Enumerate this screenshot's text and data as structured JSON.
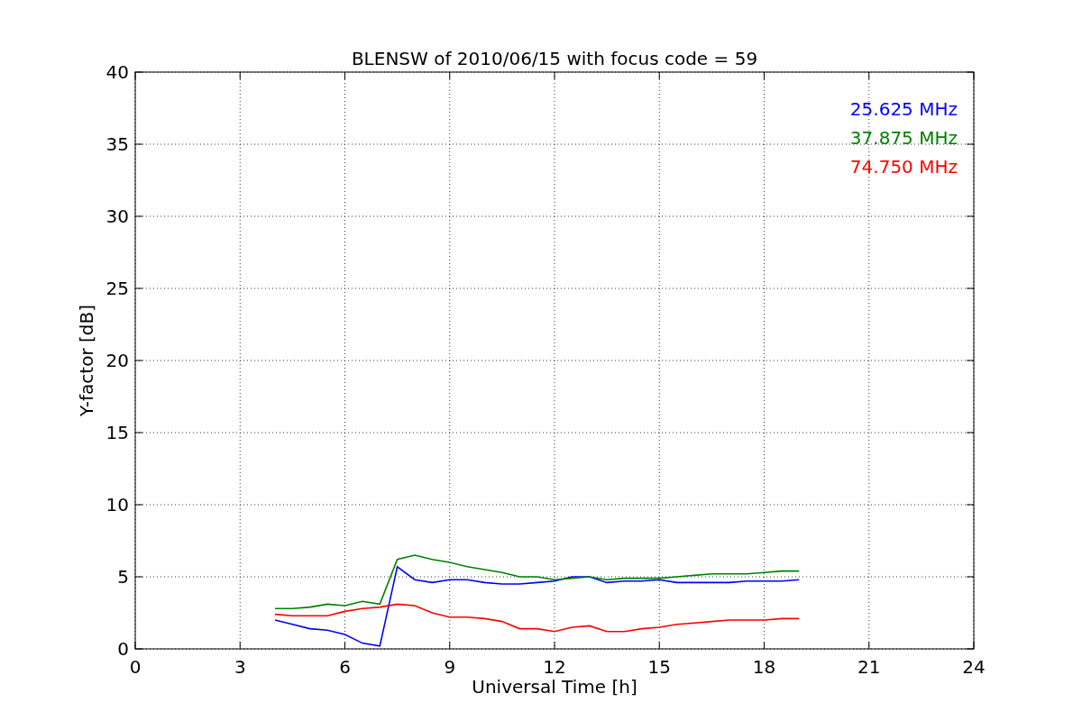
{
  "chart_data": {
    "type": "line",
    "title": "BLENSW of 2010/06/15 with focus code = 59",
    "xlabel": "Universal Time [h]",
    "ylabel": "Y-factor [dB]",
    "x": [
      4,
      4.5,
      5,
      5.5,
      6,
      6.5,
      7,
      7.5,
      8,
      8.5,
      9,
      9.5,
      10,
      10.5,
      11,
      11.5,
      12,
      12.5,
      13,
      13.5,
      14,
      14.5,
      15,
      15.5,
      16,
      16.5,
      17,
      17.5,
      18,
      18.5,
      19
    ],
    "series": [
      {
        "name": "25.625 MHz",
        "color": "#0000ff",
        "values": [
          2.0,
          1.7,
          1.4,
          1.3,
          1.0,
          0.4,
          0.2,
          5.7,
          4.8,
          4.6,
          4.8,
          4.8,
          4.6,
          4.5,
          4.5,
          4.6,
          4.7,
          5.0,
          5.0,
          4.6,
          4.7,
          4.7,
          4.8,
          4.6,
          4.6,
          4.6,
          4.6,
          4.7,
          4.7,
          4.7,
          4.8
        ]
      },
      {
        "name": "37.875 MHz",
        "color": "#008000",
        "values": [
          2.8,
          2.8,
          2.9,
          3.1,
          3.0,
          3.3,
          3.1,
          6.2,
          6.5,
          6.2,
          6.0,
          5.7,
          5.5,
          5.3,
          5.0,
          5.0,
          4.8,
          4.9,
          5.0,
          4.8,
          4.9,
          4.9,
          4.9,
          5.0,
          5.1,
          5.2,
          5.2,
          5.2,
          5.3,
          5.4,
          5.4
        ]
      },
      {
        "name": "74.750 MHz",
        "color": "#ff0000",
        "values": [
          2.4,
          2.3,
          2.3,
          2.3,
          2.6,
          2.8,
          2.9,
          3.1,
          3.0,
          2.5,
          2.2,
          2.2,
          2.1,
          1.9,
          1.4,
          1.4,
          1.2,
          1.5,
          1.6,
          1.2,
          1.2,
          1.4,
          1.5,
          1.7,
          1.8,
          1.9,
          2.0,
          2.0,
          2.0,
          2.1,
          2.1
        ]
      }
    ],
    "xlim": [
      0,
      24
    ],
    "ylim": [
      0,
      40
    ],
    "xticks": [
      0,
      3,
      6,
      9,
      12,
      15,
      18,
      21,
      24
    ],
    "yticks": [
      0,
      5,
      10,
      15,
      20,
      25,
      30,
      35,
      40
    ],
    "grid": true
  }
}
